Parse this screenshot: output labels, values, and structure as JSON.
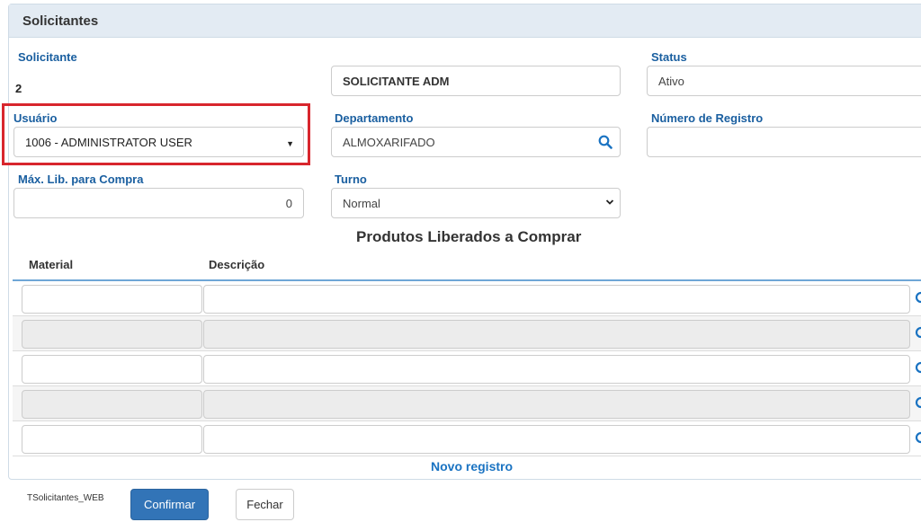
{
  "panel": {
    "title": "Solicitantes"
  },
  "form": {
    "solicitante_label": "Solicitante",
    "solicitante_code": "2",
    "solicitante_name": "SOLICITANTE ADM",
    "status_label": "Status",
    "status_value": "Ativo",
    "usuario_label": "Usuário",
    "usuario_value": "1006 - ADMINISTRATOR USER",
    "departamento_label": "Departamento",
    "departamento_value": "ALMOXARIFADO",
    "registro_label": "Número de Registro",
    "registro_value": "",
    "max_lib_label": "Máx. Lib. para Compra",
    "max_lib_value": "0",
    "turno_label": "Turno",
    "turno_value": "Normal"
  },
  "products": {
    "title": "Produtos Liberados a Comprar",
    "columns": [
      "Material",
      "Descrição"
    ],
    "rows": [
      {
        "material": "",
        "descricao": ""
      },
      {
        "material": "",
        "descricao": ""
      },
      {
        "material": "",
        "descricao": ""
      },
      {
        "material": "",
        "descricao": ""
      },
      {
        "material": "",
        "descricao": ""
      }
    ],
    "new_record_label": "Novo registro"
  },
  "footer": {
    "form_id": "TSolicitantes_WEB",
    "confirm_label": "Confirmar",
    "close_label": "Fechar"
  },
  "colors": {
    "accent": "#1a5fa0",
    "primary_button": "#3274b7",
    "highlight": "#d8262d"
  },
  "icons": {
    "search": "search-icon",
    "dropdown": "caret-down-icon",
    "select": "chevron-down-icon"
  }
}
